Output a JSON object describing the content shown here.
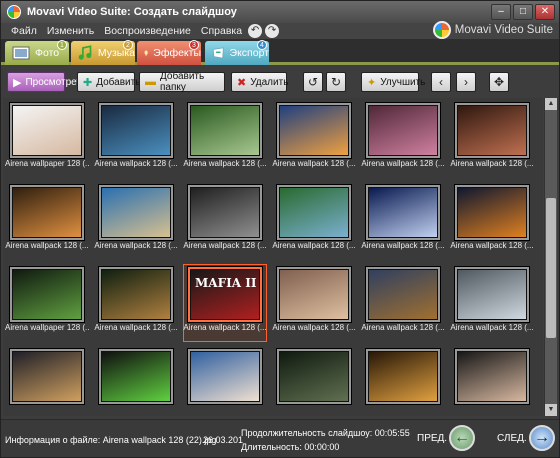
{
  "window": {
    "title": "Movavi Video Suite: Создать слайдшоу",
    "brand": "Movavi Video Suite"
  },
  "menu": [
    "Файл",
    "Изменить",
    "Воспроизведение",
    "Справка"
  ],
  "tabs": [
    {
      "label": "Фото",
      "badge": "1",
      "icon": "photo-icon"
    },
    {
      "label": "Музыка",
      "badge": "2",
      "icon": "music-icon"
    },
    {
      "label": "Эффекты",
      "badge": "3",
      "icon": "effects-icon"
    },
    {
      "label": "Экспорт",
      "badge": "4",
      "icon": "export-icon"
    }
  ],
  "toolbar": {
    "view": "Просмотреть",
    "add": "Добавить",
    "add_folder": "Добавить папку",
    "delete": "Удалить",
    "enhance": "Улучшить"
  },
  "thumbnails": [
    {
      "caption": "Airena wallpaper 128 (...",
      "colors": [
        "#f4f4f4",
        "#d6b8a0"
      ],
      "selected": false
    },
    {
      "caption": "Airena wallpack 128 (...",
      "colors": [
        "#1a2a40",
        "#4a90c0"
      ],
      "selected": false
    },
    {
      "caption": "Airena wallpack 128 (...",
      "colors": [
        "#2a5a20",
        "#a8c890"
      ],
      "selected": false
    },
    {
      "caption": "Airena wallpack 128 (...",
      "colors": [
        "#204080",
        "#f0a040"
      ],
      "selected": false
    },
    {
      "caption": "Airena wallpack 128 (...",
      "colors": [
        "#502838",
        "#d080a0"
      ],
      "selected": false
    },
    {
      "caption": "Airena wallpack 128 (...",
      "colors": [
        "#301810",
        "#c07050"
      ],
      "selected": false
    },
    {
      "caption": "Airena wallpack 128 (...",
      "colors": [
        "#302010",
        "#e09040"
      ],
      "selected": false
    },
    {
      "caption": "Airena wallpack 128 (...",
      "colors": [
        "#2a70b0",
        "#d8c090"
      ],
      "selected": false
    },
    {
      "caption": "Airena wallpack 128 (...",
      "colors": [
        "#202020",
        "#909090"
      ],
      "selected": false
    },
    {
      "caption": "Airena wallpack 128 (...",
      "colors": [
        "#2a6a30",
        "#7ab0d0"
      ],
      "selected": false
    },
    {
      "caption": "Airena wallpack 128 (...",
      "colors": [
        "#0a1a50",
        "#c0d0f0"
      ],
      "selected": false
    },
    {
      "caption": "Airena wallpack 128 (...",
      "colors": [
        "#101830",
        "#e08020"
      ],
      "selected": false
    },
    {
      "caption": "Airena wallpaper 128 (...",
      "colors": [
        "#101a10",
        "#60a040"
      ],
      "selected": false
    },
    {
      "caption": "Airena wallpack 128 (...",
      "colors": [
        "#102010",
        "#b08040"
      ],
      "selected": false
    },
    {
      "caption": "Airena wallpack 128 (...",
      "colors": [
        "#181818",
        "#b02020"
      ],
      "selected": true,
      "title_text": "MAFIA II"
    },
    {
      "caption": "Airena wallpack 128 (...",
      "colors": [
        "#806050",
        "#e0c0a0"
      ],
      "selected": false
    },
    {
      "caption": "Airena wallpack 128 (...",
      "colors": [
        "#304060",
        "#a07030"
      ],
      "selected": false
    },
    {
      "caption": "Airena wallpack 128 (...",
      "colors": [
        "#505860",
        "#d0d8e0"
      ],
      "selected": false
    },
    {
      "caption": "",
      "colors": [
        "#202028",
        "#d0a060"
      ],
      "selected": false
    },
    {
      "caption": "",
      "colors": [
        "#101010",
        "#60d040"
      ],
      "selected": false
    },
    {
      "caption": "",
      "colors": [
        "#3060a0",
        "#f0e0d0"
      ],
      "selected": false
    },
    {
      "caption": "",
      "colors": [
        "#101a10",
        "#607050"
      ],
      "selected": false
    },
    {
      "caption": "",
      "colors": [
        "#281808",
        "#e0a040"
      ],
      "selected": false
    },
    {
      "caption": "",
      "colors": [
        "#181818",
        "#d8b8a0"
      ],
      "selected": false
    }
  ],
  "status": {
    "file_info": "Информация о файле: Airena wallpack 128 (22).jpg",
    "date": "26.03.201",
    "slideshow_duration": "Продолжительность слайдшоу: 00:05:55",
    "duration": "Длительность: 00:00:00",
    "prev": "ПРЕД.",
    "next": "СЛЕД."
  }
}
